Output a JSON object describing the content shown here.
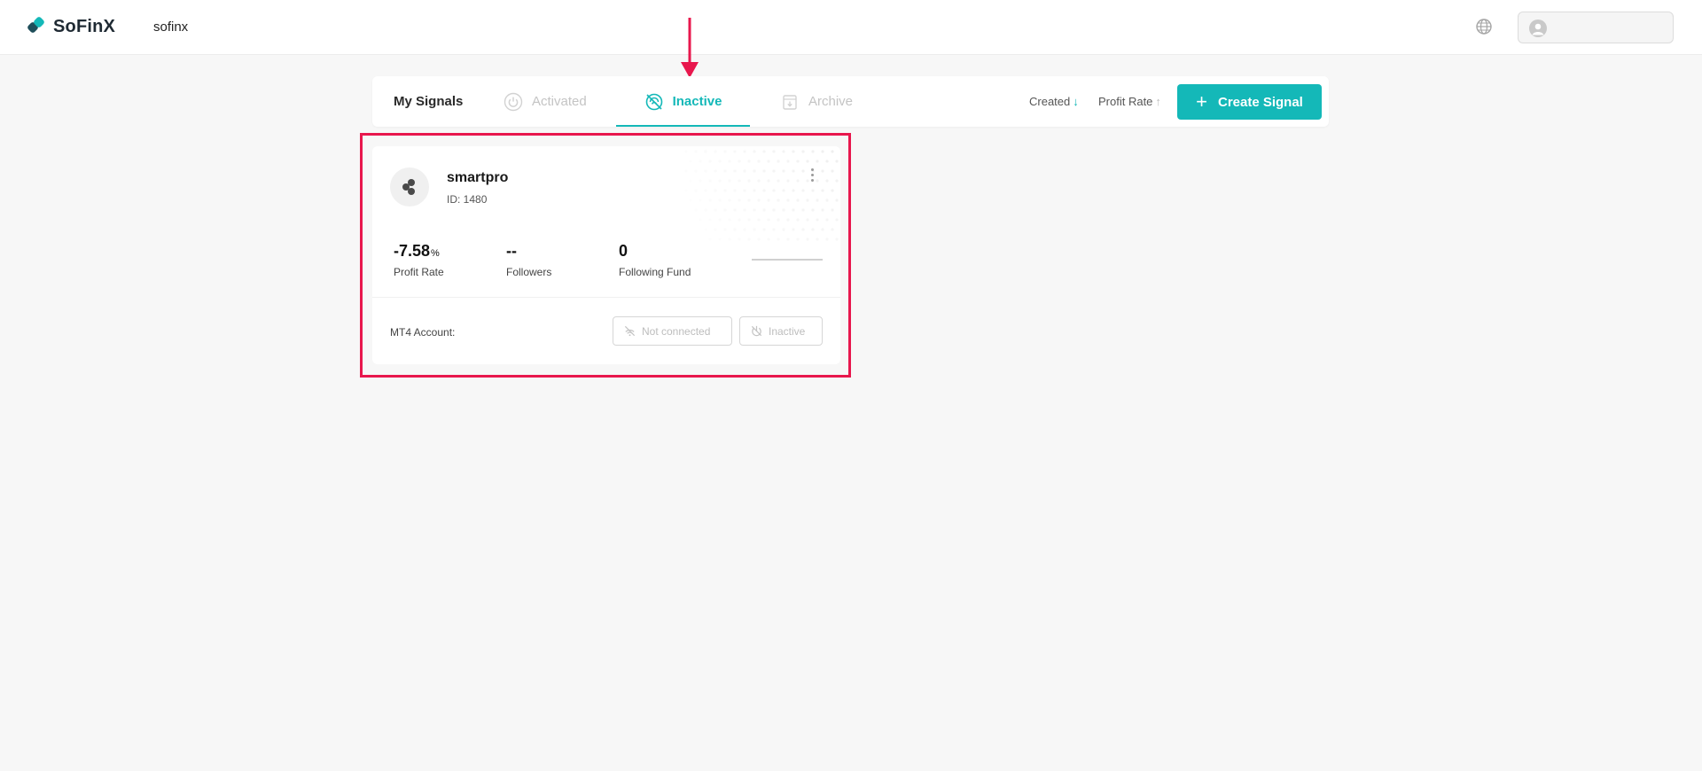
{
  "header": {
    "brand": "SoFinX",
    "workspace": "sofinx",
    "icons": {
      "language": "globe-icon",
      "user": "user-avatar-icon"
    }
  },
  "tabs": {
    "title": "My Signals",
    "items": [
      {
        "label": "Activated",
        "icon": "power-icon",
        "active": false
      },
      {
        "label": "Inactive",
        "icon": "no-signal-icon",
        "active": true
      },
      {
        "label": "Archive",
        "icon": "archive-icon",
        "active": false
      }
    ],
    "sort": {
      "created": "Created",
      "profit_rate": "Profit Rate"
    },
    "create_button": "Create Signal"
  },
  "signal_card": {
    "name": "smartpro",
    "id_text": "ID: 1480",
    "stats": [
      {
        "value": "-7.58",
        "unit": "%",
        "label": "Profit Rate"
      },
      {
        "value": "--",
        "unit": "",
        "label": "Followers"
      },
      {
        "value": "0",
        "unit": "",
        "label": "Following Fund"
      }
    ],
    "mt4_label": "MT4 Account:",
    "status_connection": "Not connected",
    "status_state": "Inactive"
  },
  "colors": {
    "accent": "#14b8b8",
    "annotation": "#e8174d",
    "page_bg": "#f7f7f7"
  }
}
